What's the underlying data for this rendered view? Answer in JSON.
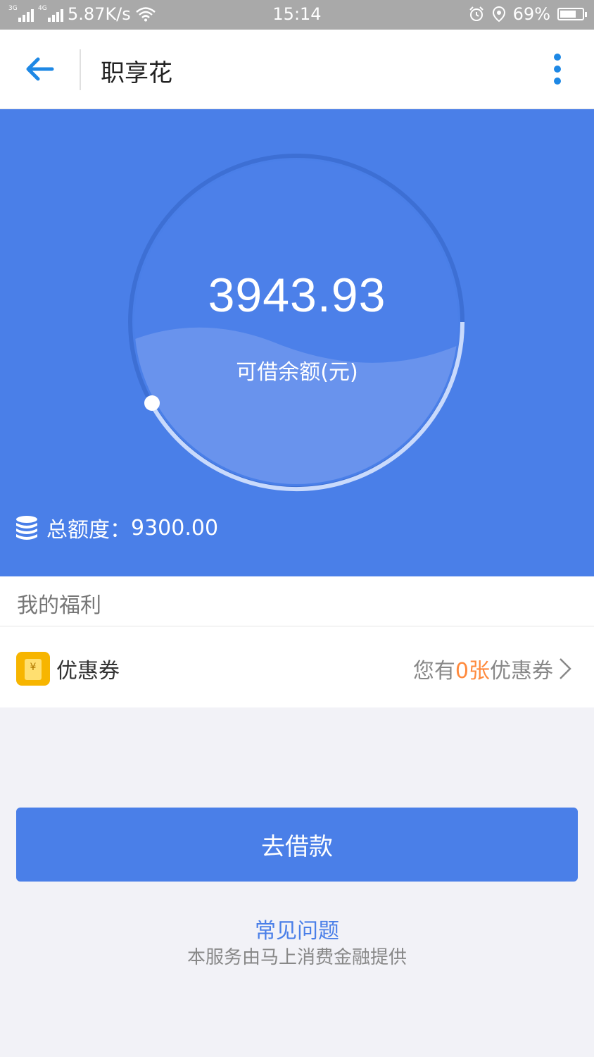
{
  "status_bar": {
    "signal1_tag": "3G",
    "signal2_tag": "4G",
    "net_speed": "5.87K/s",
    "time": "15:14",
    "battery": "69%",
    "battery_level": 0.69
  },
  "header": {
    "title": "职享花"
  },
  "credit": {
    "available_amount": "3943.93",
    "available_label": "可借余额(元)",
    "total_label": "总额度：",
    "total_amount": "9300.00",
    "available_fraction": 0.424
  },
  "welfare": {
    "section_title": "我的福利",
    "coupon_label": "优惠券",
    "coupon_info_prefix": "您有",
    "coupon_count": "0张",
    "coupon_info_suffix": "优惠券"
  },
  "actions": {
    "borrow_button": "去借款",
    "faq_link": "常见问题",
    "provider_note": "本服务由马上消费金融提供"
  },
  "colors": {
    "brand_blue": "#4a7fe8",
    "accent_orange": "#ff8a3d",
    "coupon_yellow": "#f7b500",
    "icon_blue": "#1e88e5"
  }
}
